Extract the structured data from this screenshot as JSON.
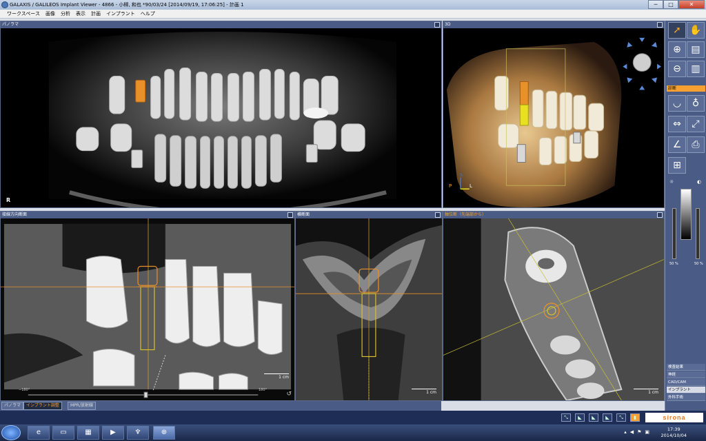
{
  "window": {
    "title": "GALAXIS / GALILEOS Implant Viewer - 4866 - 小柳, 和也 *90/03/24 [2014/09/19, 17:06:25] - 計画 1",
    "minimize": "─",
    "maximize": "□",
    "close": "✕"
  },
  "menu": [
    "ワークスペース",
    "画像",
    "分析",
    "表示",
    "計画",
    "インプラント",
    "ヘルプ"
  ],
  "panels": {
    "panorama": {
      "title": "パノラマ",
      "marker": "R"
    },
    "view3d": {
      "title": "3D",
      "axes": [
        "P",
        "L",
        "S"
      ]
    },
    "tangential": {
      "title": "接線方向断面",
      "scale": "1 cm",
      "slider_min": "−180°",
      "slider_max": "180°"
    },
    "cross": {
      "title": "横断面",
      "scale": "1 cm"
    },
    "axial": {
      "title": "軸位断（先端部から）",
      "scale": "1 cm"
    }
  },
  "right_toolbar": {
    "section_label": "診断",
    "contrast_pct_left": "50 %",
    "contrast_pct_right": "50 %",
    "list": [
      "検査結果",
      "神経",
      "CAD/CAM",
      "インプラント",
      "外科手術"
    ],
    "active_list_index": 3
  },
  "tabs": [
    {
      "label": "パノラマ",
      "active": false
    },
    {
      "label": "インプラント調整",
      "active": true
    },
    {
      "label": "MPR/放射線",
      "active": false
    }
  ],
  "brand": "sirona",
  "clock": {
    "time": "17:39",
    "date": "2014/10/04"
  },
  "colors": {
    "accent": "#f5a030",
    "panel_header": "#4a5c86",
    "implant": "#e8902a"
  }
}
